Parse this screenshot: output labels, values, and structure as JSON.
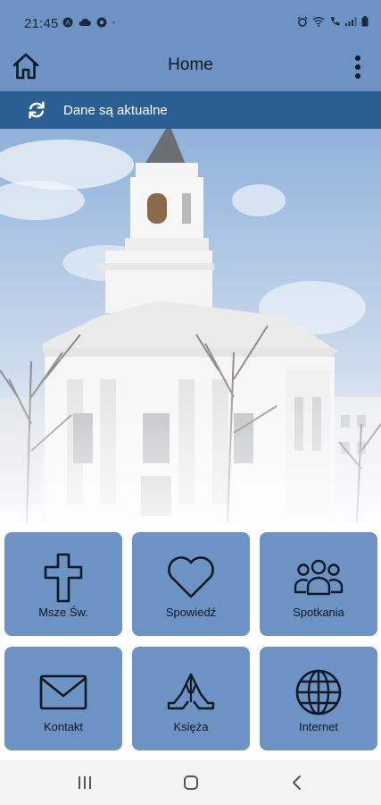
{
  "status_bar": {
    "time": "21:45",
    "left_icons": [
      "auto-icon",
      "cloud-icon",
      "app-icon",
      "dot-icon"
    ],
    "right_icons": [
      "alarm-icon",
      "wifi-icon",
      "call-icon",
      "signal-icon",
      "battery-icon"
    ]
  },
  "app_bar": {
    "title": "Home",
    "home_icon": "home-icon",
    "menu_icon": "more-vertical-icon"
  },
  "sync_bar": {
    "text": "Dane są aktualne",
    "icon": "refresh-icon"
  },
  "hero": {
    "description_icon": "church-photo"
  },
  "tiles": [
    {
      "label": "Msze Św.",
      "icon": "cross-icon"
    },
    {
      "label": "Spowiedź",
      "icon": "heart-icon"
    },
    {
      "label": "Spotkania",
      "icon": "group-icon"
    },
    {
      "label": "Kontakt",
      "icon": "envelope-icon"
    },
    {
      "label": "Księża",
      "icon": "praying-hands-icon"
    },
    {
      "label": "Internet",
      "icon": "globe-icon"
    }
  ],
  "nav_bar": {
    "recents_icon": "recents-icon",
    "home_icon": "nav-home-icon",
    "back_icon": "back-icon"
  },
  "colors": {
    "app_bar": "#6c93c4",
    "sync_bar": "#2b5e93",
    "tile": "#6c93c4",
    "nav_bar": "#f4f4f4"
  }
}
